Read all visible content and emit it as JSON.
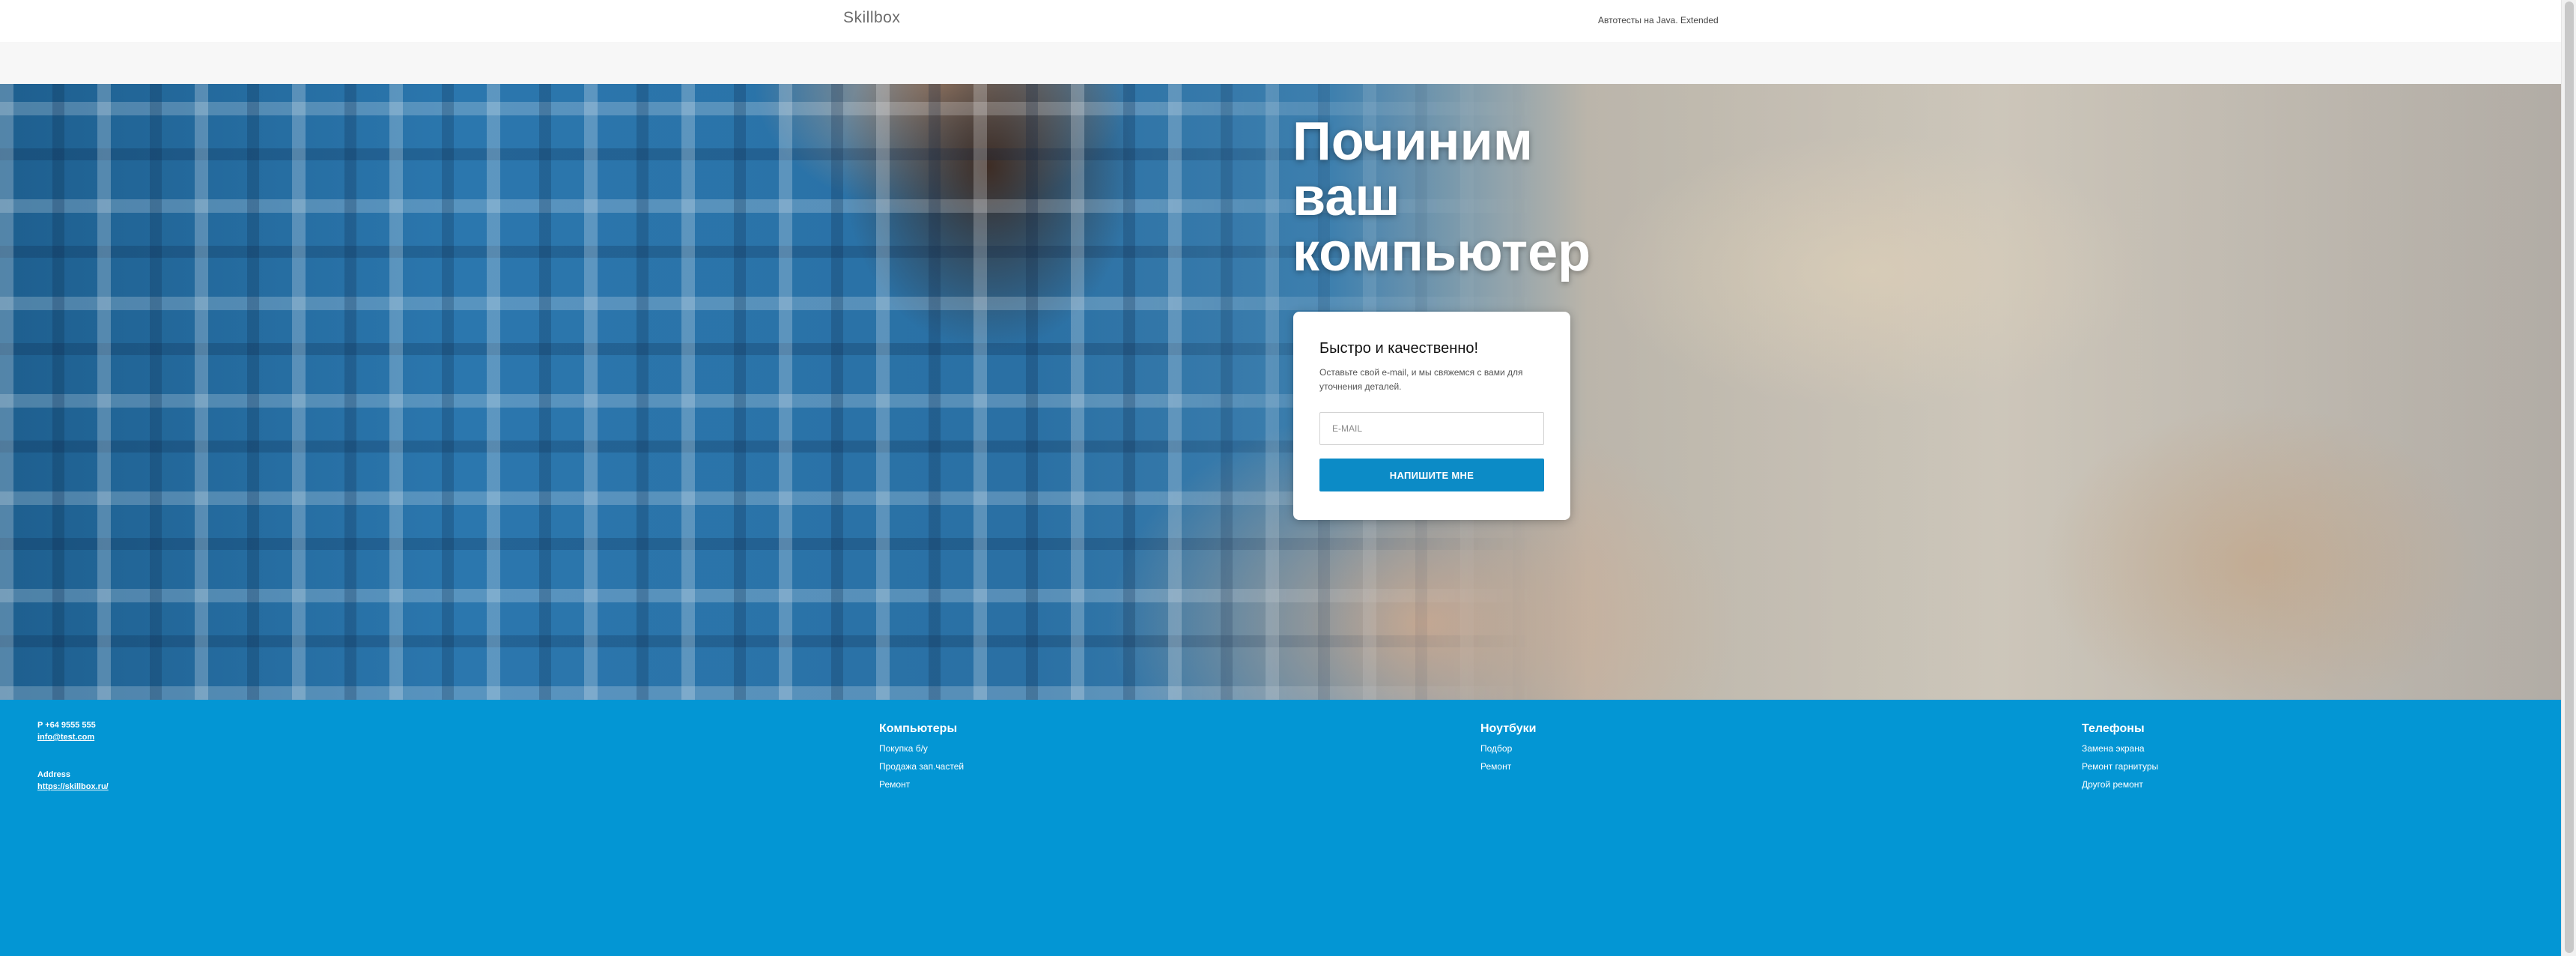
{
  "header": {
    "logo": "Skillbox",
    "top_link": "Автотесты на Java. Extended"
  },
  "hero": {
    "headline": [
      "Починим",
      "ваш",
      "компьютер"
    ],
    "card": {
      "title": "Быстро и качественно!",
      "description": "Оставьте свой e-mail, и мы свяжемся с вами для уточнения деталей.",
      "email_placeholder": "E-MAIL",
      "email_value": "",
      "button_label": "НАПИШИТЕ МНЕ"
    }
  },
  "footer": {
    "phone": "P +64 9555 555",
    "email": "info@test.com",
    "address_label": "Address",
    "site": "https://skillbox.ru/",
    "columns": [
      {
        "title": "Компьютеры",
        "items": [
          "Покупка б/у",
          "Продажа зап.частей",
          "Ремонт"
        ]
      },
      {
        "title": "Ноутбуки",
        "items": [
          "Подбор",
          "Ремонт"
        ]
      },
      {
        "title": "Телефоны",
        "items": [
          "Замена экрана",
          "Ремонт гарнитуры",
          "Другой ремонт"
        ]
      }
    ]
  },
  "colors": {
    "accent": "#0c8bc6",
    "footer_bg": "#0396d4"
  }
}
